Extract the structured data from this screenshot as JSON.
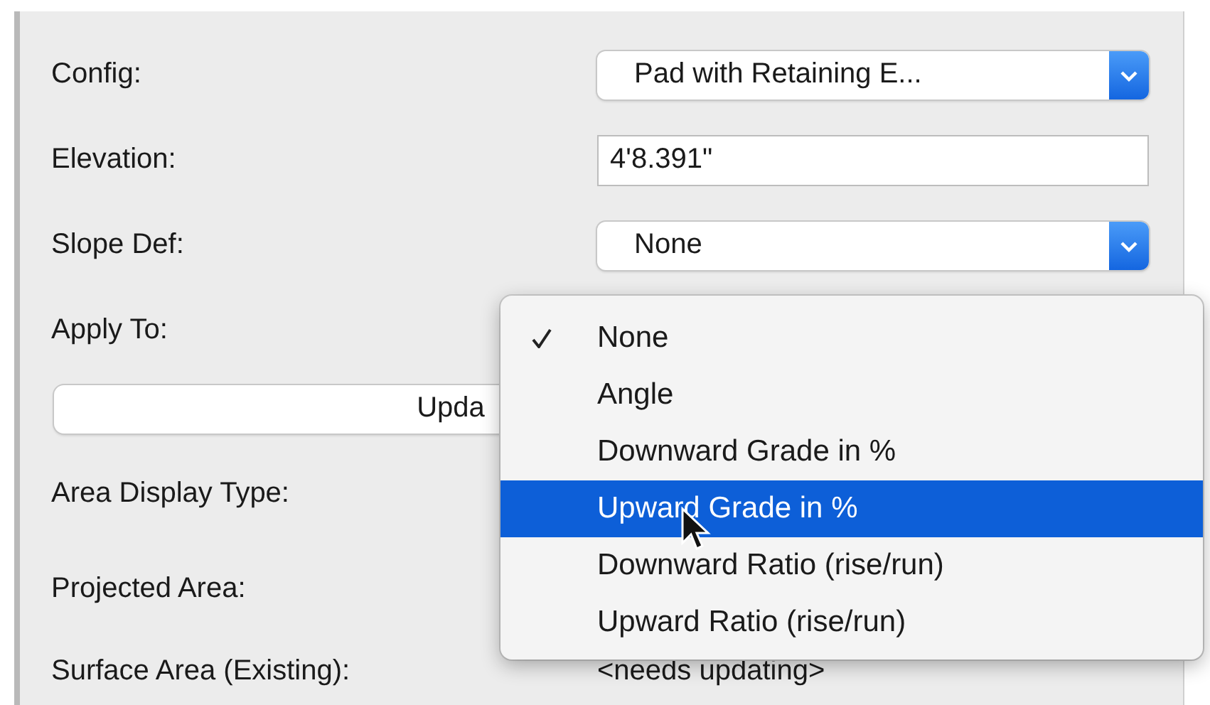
{
  "fields": [
    {
      "kind": "popup",
      "label": "Config:",
      "value": "Pad with Retaining E..."
    },
    {
      "kind": "text",
      "label": "Elevation:",
      "value": "4'8.391\""
    },
    {
      "kind": "popup",
      "label": "Slope Def:",
      "value": "None"
    },
    {
      "kind": "label",
      "label": "Apply To:"
    },
    {
      "kind": "button",
      "label": "Upda"
    },
    {
      "kind": "label",
      "label": "Area Display Type:"
    },
    {
      "kind": "label",
      "label": "Projected Area:"
    },
    {
      "kind": "readout",
      "label": "Surface Area (Existing):",
      "value": "<needs updating>"
    }
  ],
  "menu": {
    "items": [
      {
        "label": "None",
        "checked": true,
        "selected": false
      },
      {
        "label": "Angle",
        "checked": false,
        "selected": false
      },
      {
        "label": "Downward Grade in %",
        "checked": false,
        "selected": false
      },
      {
        "label": "Upward Grade in %",
        "checked": false,
        "selected": true
      },
      {
        "label": "Downward Ratio (rise/run)",
        "checked": false,
        "selected": false
      },
      {
        "label": "Upward Ratio (rise/run)",
        "checked": false,
        "selected": false
      }
    ]
  }
}
